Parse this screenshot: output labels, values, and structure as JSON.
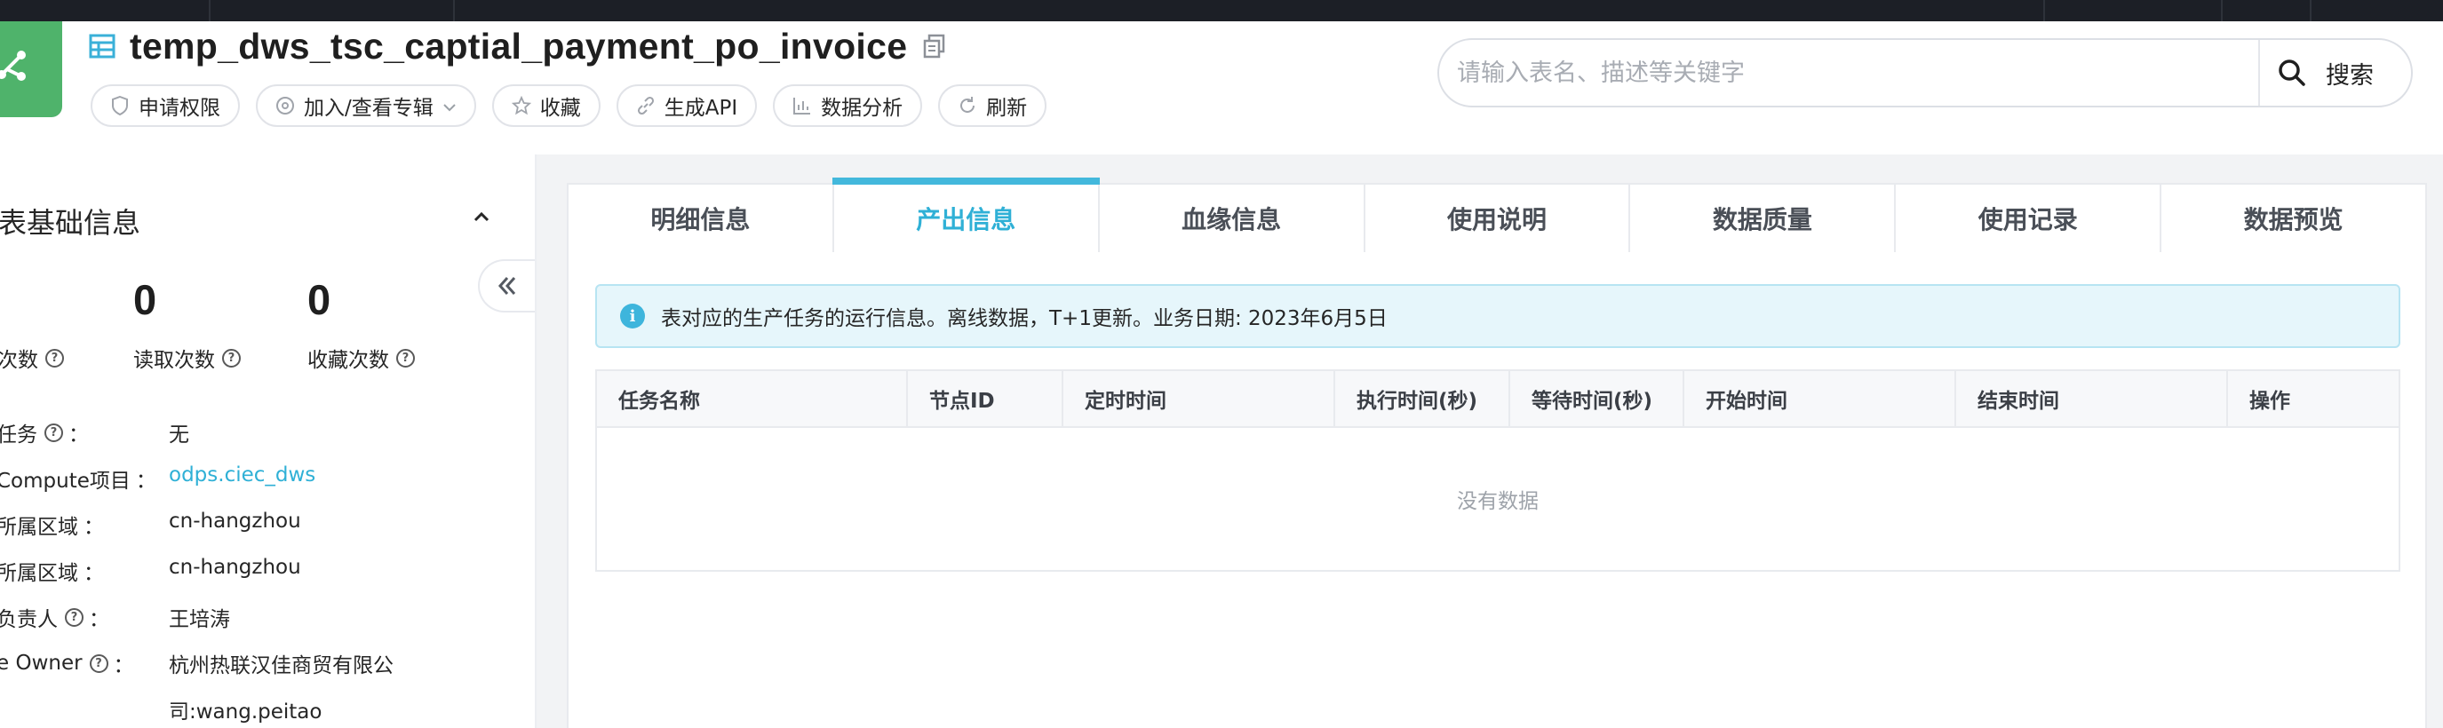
{
  "app": {
    "title": "temp_dws_tsc_captial_payment_po_invoice"
  },
  "actions": [
    {
      "label": "申请权限",
      "icon": "shield-icon"
    },
    {
      "label": "加入/查看专辑",
      "icon": "album-icon",
      "has_dropdown": true
    },
    {
      "label": "收藏",
      "icon": "star-icon"
    },
    {
      "label": "生成API",
      "icon": "link-icon"
    },
    {
      "label": "数据分析",
      "icon": "bar-chart-icon"
    },
    {
      "label": "刷新",
      "icon": "refresh-icon"
    }
  ],
  "search": {
    "placeholder": "请输入表名、描述等关键字",
    "value": "",
    "button_label": "搜索"
  },
  "sidebar": {
    "section_title": "表基础信息",
    "stats": [
      {
        "label": "次数",
        "value": ""
      },
      {
        "label": "读取次数",
        "value": "0"
      },
      {
        "label": "收藏次数",
        "value": "0"
      }
    ],
    "info": [
      {
        "label": "任务",
        "help": true,
        "value": "无",
        "link": false
      },
      {
        "label": "Compute项目",
        "help": false,
        "value": "odps.ciec_dws",
        "link": true
      },
      {
        "label": "所属区域",
        "help": false,
        "value": "cn-hangzhou",
        "link": false
      },
      {
        "label": "所属区域",
        "help": false,
        "value": "cn-hangzhou",
        "link": false
      },
      {
        "label": "负责人",
        "help": true,
        "value": "王培涛",
        "link": false
      },
      {
        "label": "e Owner",
        "help": true,
        "value": "杭州热联汉佳商贸有限公",
        "value_line2": "司:wang.peitao",
        "link": false
      }
    ]
  },
  "tabs": [
    {
      "label": "明细信息",
      "active": false
    },
    {
      "label": "产出信息",
      "active": true
    },
    {
      "label": "血缘信息",
      "active": false
    },
    {
      "label": "使用说明",
      "active": false
    },
    {
      "label": "数据质量",
      "active": false
    },
    {
      "label": "使用记录",
      "active": false
    },
    {
      "label": "数据预览",
      "active": false
    }
  ],
  "notice": "表对应的生产任务的运行信息。离线数据，T+1更新。业务日期: 2023年6月5日",
  "table": {
    "columns": [
      "任务名称",
      "节点ID",
      "定时时间",
      "执行时间(秒)",
      "等待时间(秒)",
      "开始时间",
      "结束时间",
      "操作"
    ],
    "rows": [],
    "empty_text": "没有数据"
  },
  "colors": {
    "accent": "#2fb0d6",
    "logo_green": "#4fb36b",
    "link": "#2fb0d6"
  }
}
